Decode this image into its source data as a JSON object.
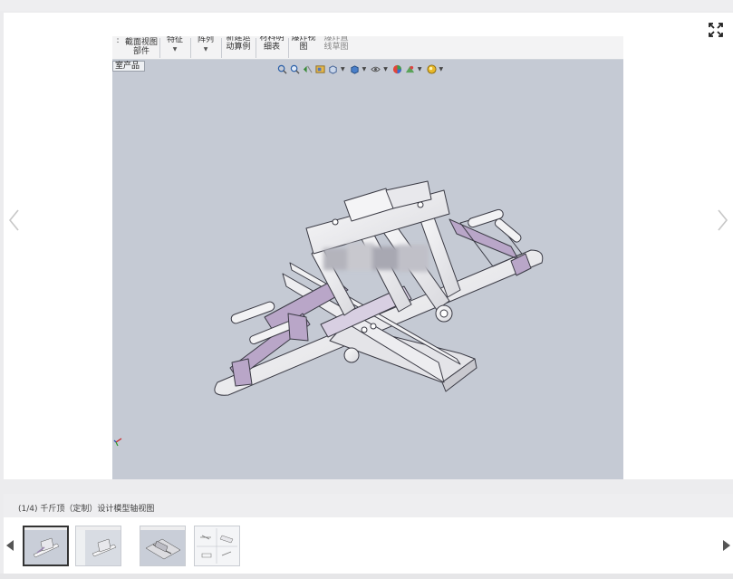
{
  "cad_ribbon": {
    "items": [
      {
        "label": "装配体\n截面视图\n部件"
      },
      {
        "label": "特征"
      },
      {
        "label": "阵列"
      },
      {
        "label": "新建运\n动算例"
      },
      {
        "label": "材料明\n细表"
      },
      {
        "label": "爆炸视\n图"
      },
      {
        "label": "爆炸直\n线草图"
      }
    ],
    "tab_label": "室产品"
  },
  "gallery": {
    "caption": "(1/4) 千斤顶（定制）设计模型轴视图",
    "thumbnails": [
      {
        "name": "view-1",
        "active": true
      },
      {
        "name": "view-2",
        "active": false
      },
      {
        "name": "view-3",
        "active": false
      },
      {
        "name": "view-4",
        "active": false
      }
    ]
  },
  "colors": {
    "cad_background": "#c5cad4",
    "model_steel": "#e9e9ec",
    "model_lilac": "#b9a6c8",
    "page_background": "#ececee"
  }
}
